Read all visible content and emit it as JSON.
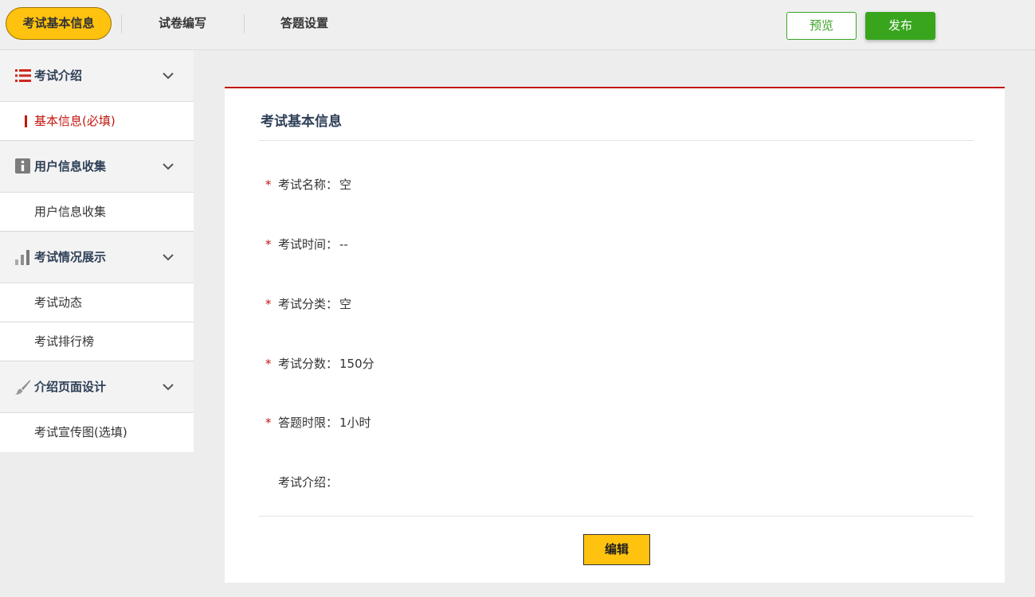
{
  "tabs": [
    {
      "label": "考试基本信息"
    },
    {
      "label": "试卷编写"
    },
    {
      "label": "答题设置"
    }
  ],
  "actions": {
    "preview": "预览",
    "publish": "发布"
  },
  "sidebar": {
    "sections": [
      {
        "title": "考试介绍",
        "icon": "list-icon",
        "items": [
          "基本信息(必填)"
        ]
      },
      {
        "title": "用户信息收集",
        "icon": "info-icon",
        "items": [
          "用户信息收集"
        ]
      },
      {
        "title": "考试情况展示",
        "icon": "bar-chart-icon",
        "items": [
          "考试动态",
          "考试排行榜"
        ]
      },
      {
        "title": "介绍页面设计",
        "icon": "brush-icon",
        "items": [
          "考试宣传图(选填)"
        ]
      }
    ]
  },
  "panel": {
    "title": "考试基本信息",
    "fields": [
      {
        "label": "考试名称：",
        "value": "空",
        "required": true
      },
      {
        "label": "考试时间：",
        "value": "--",
        "required": true
      },
      {
        "label": "考试分类：",
        "value": "空",
        "required": true
      },
      {
        "label": "考试分数：",
        "value": "150分",
        "required": true
      },
      {
        "label": "答题时限：",
        "value": "1小时",
        "required": true
      },
      {
        "label": "考试介绍：",
        "value": "",
        "required": false
      }
    ],
    "required_mark": "*",
    "edit_button": "编辑"
  },
  "colors": {
    "accent_yellow": "#ffc20e",
    "accent_green": "#38a51d",
    "accent_red": "#c0170f",
    "heading_navy": "#2e3f57"
  }
}
